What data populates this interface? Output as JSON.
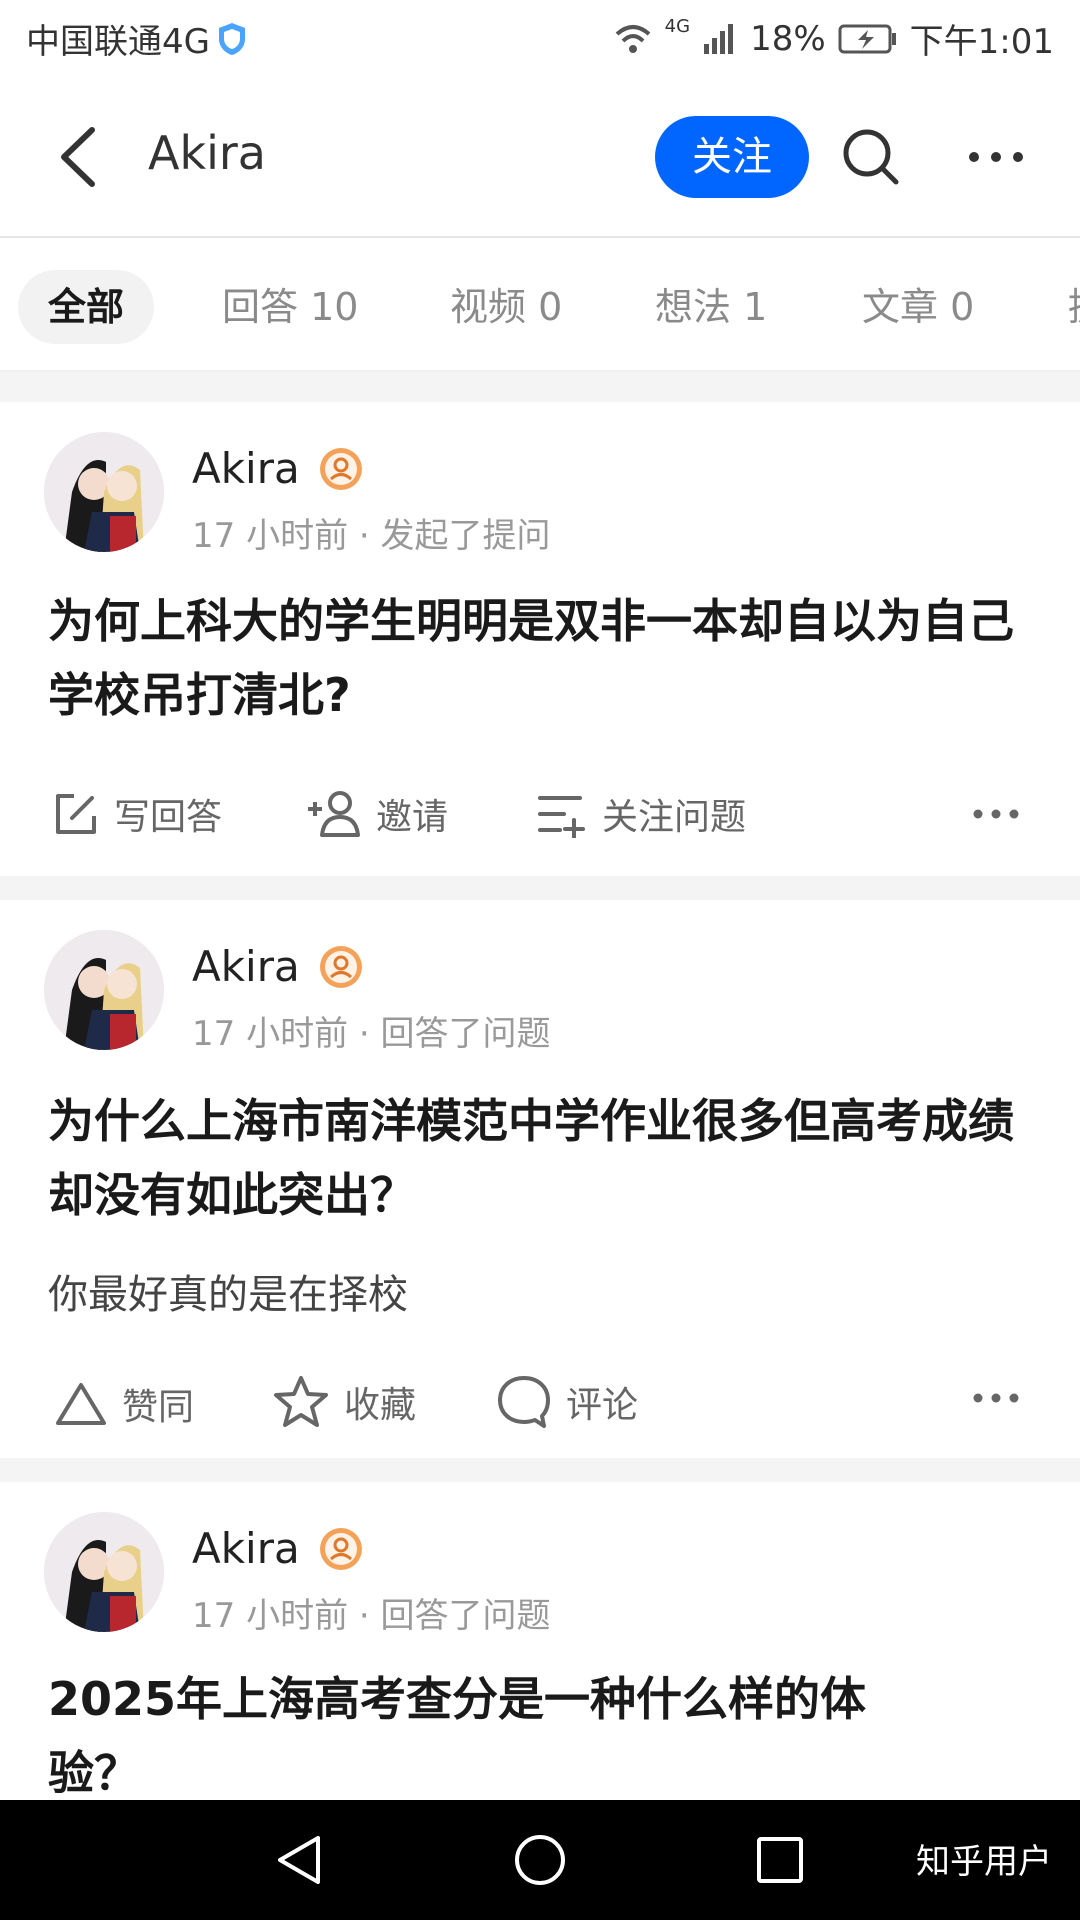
{
  "status_bar": {
    "carrier": "中国联通4G",
    "signal": "4G",
    "battery": "18%",
    "time": "下午1:01"
  },
  "header": {
    "title": "Akira",
    "follow_label": "关注"
  },
  "tabs": [
    {
      "label": "全部"
    },
    {
      "label": "回答 10"
    },
    {
      "label": "视频 0"
    },
    {
      "label": "想法 1"
    },
    {
      "label": "文章 0"
    },
    {
      "label": "提"
    }
  ],
  "cards": [
    {
      "author": "Akira",
      "meta": "17 小时前 · 发起了提问",
      "title": "为何上科大的学生明明是双非一本却自以为自己学校吊打清北?",
      "actions": [
        "写回答",
        "邀请",
        "关注问题"
      ]
    },
    {
      "author": "Akira",
      "meta": "17 小时前 · 回答了问题",
      "title": "为什么上海市南洋模范中学作业很多但高考成绩却没有如此突出？",
      "excerpt": "你最好真的是在择校",
      "actions": [
        "赞同",
        "收藏",
        "评论"
      ]
    },
    {
      "author": "Akira",
      "meta": "17 小时前 · 回答了问题",
      "title": "2025年上海高考查分是一种什么样的体验？"
    }
  ],
  "watermark": "知乎用户",
  "colors": {
    "accent": "#0066ff",
    "badge": "#f08a3a"
  },
  "icons": [
    "back-arrow-icon",
    "search-icon",
    "more-dots-icon",
    "edit-icon",
    "invite-user-icon",
    "follow-question-icon",
    "upvote-icon",
    "star-icon",
    "comment-icon"
  ]
}
